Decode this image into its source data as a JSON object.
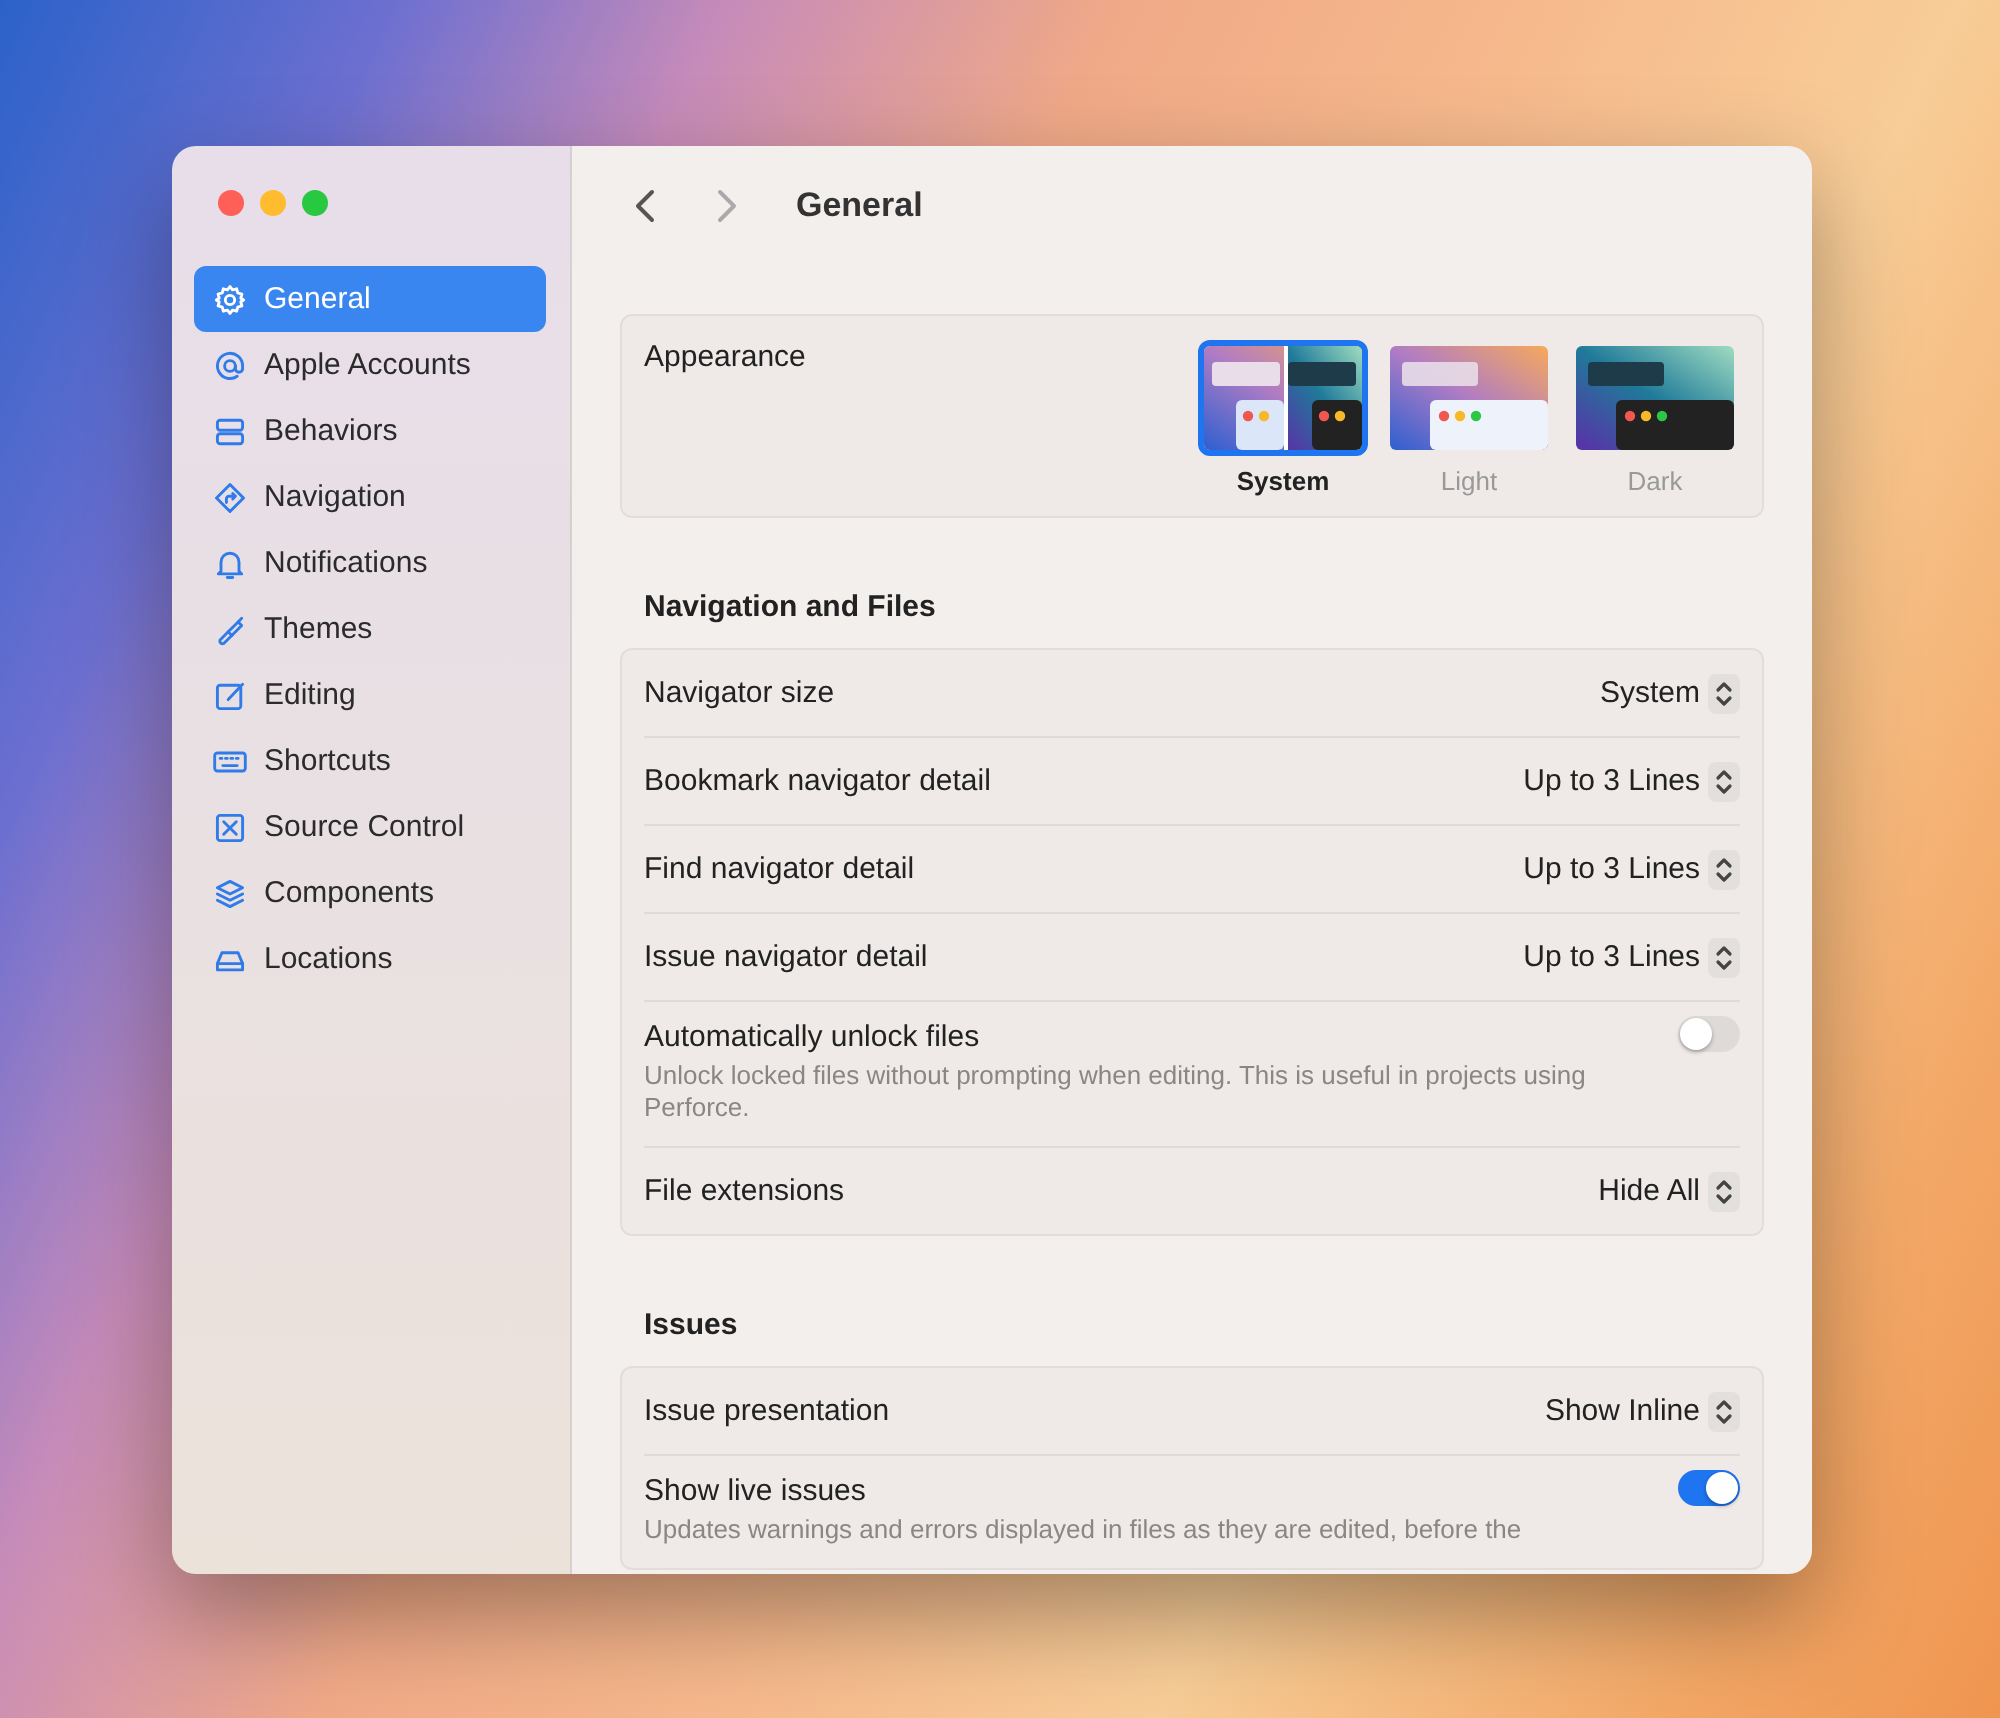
{
  "window": {
    "title": "General",
    "traffic_lights": [
      {
        "color": "#fe5f57"
      },
      {
        "color": "#febc2e"
      },
      {
        "color": "#28c840"
      }
    ]
  },
  "sidebar": {
    "items": [
      {
        "label": "General",
        "selected": true
      },
      {
        "label": "Apple Accounts",
        "selected": false
      },
      {
        "label": "Behaviors",
        "selected": false
      },
      {
        "label": "Navigation",
        "selected": false
      },
      {
        "label": "Notifications",
        "selected": false
      },
      {
        "label": "Themes",
        "selected": false
      },
      {
        "label": "Editing",
        "selected": false
      },
      {
        "label": "Shortcuts",
        "selected": false
      },
      {
        "label": "Source Control",
        "selected": false
      },
      {
        "label": "Components",
        "selected": false
      },
      {
        "label": "Locations",
        "selected": false
      }
    ]
  },
  "appearance": {
    "label": "Appearance",
    "options": [
      {
        "label": "System",
        "kind": "system",
        "selected": true
      },
      {
        "label": "Light",
        "kind": "light",
        "selected": false
      },
      {
        "label": "Dark",
        "kind": "dark",
        "selected": false
      }
    ]
  },
  "sections": [
    {
      "title": "Navigation and Files",
      "rows": [
        {
          "kind": "popup",
          "label": "Navigator size",
          "value": "System"
        },
        {
          "kind": "popup",
          "label": "Bookmark navigator detail",
          "value": "Up to 3 Lines"
        },
        {
          "kind": "popup",
          "label": "Find navigator detail",
          "value": "Up to 3 Lines"
        },
        {
          "kind": "popup",
          "label": "Issue navigator detail",
          "value": "Up to 3 Lines"
        },
        {
          "kind": "toggle",
          "label": "Automatically unlock files",
          "description": "Unlock locked files without prompting when editing. This is useful in projects using Perforce.",
          "on": false
        },
        {
          "kind": "popup",
          "label": "File extensions",
          "value": "Hide All"
        }
      ]
    },
    {
      "title": "Issues",
      "rows": [
        {
          "kind": "popup",
          "label": "Issue presentation",
          "value": "Show Inline"
        },
        {
          "kind": "toggle",
          "label": "Show live issues",
          "description": "Updates warnings and errors displayed in files as they are edited, before the",
          "on": true
        }
      ]
    }
  ]
}
